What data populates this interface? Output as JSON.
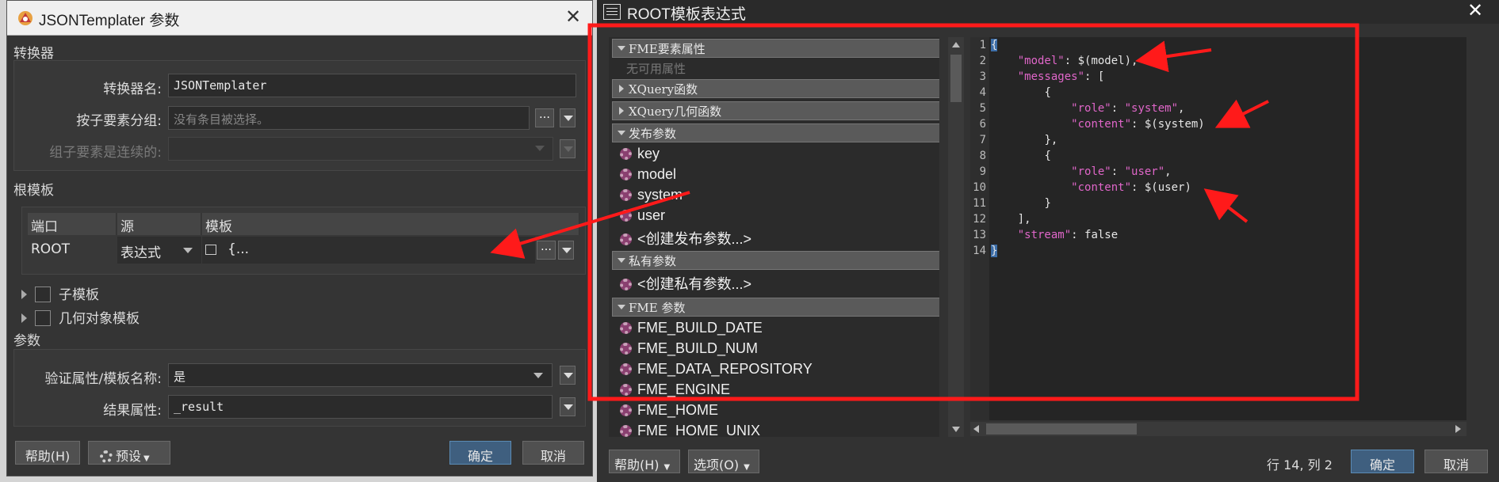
{
  "left_dialog": {
    "title": "JSONTemplater 参数",
    "section_transformer": "转换器",
    "transformer_name_label": "转换器名:",
    "transformer_name_value": "JSONTemplater",
    "group_by_label": "按子要素分组:",
    "group_by_placeholder": "没有条目被选择。",
    "group_consecutive_label": "组子要素是连续的:",
    "section_root_template": "根模板",
    "table_headers": [
      "端口",
      "源",
      "模板"
    ],
    "table_row": {
      "port": "ROOT",
      "source": "表达式",
      "template": "{..."
    },
    "sub_template": "子模板",
    "geometry_template": "几何对象模板",
    "section_params": "参数",
    "validate_label": "验证属性/模板名称:",
    "validate_value": "是",
    "result_attr_label": "结果属性:",
    "result_attr_value": "_result",
    "help_button": "帮助(H)",
    "presets_button": "预设",
    "ok_button": "确定",
    "cancel_button": "取消"
  },
  "right_dialog": {
    "title": "ROOT模板表达式",
    "tree": {
      "fme_feature_attributes": "FME要素属性",
      "no_attributes": "无可用属性",
      "xquery_functions": "XQuery函数",
      "xquery_geometry_functions": "XQuery几何函数",
      "published_params": "发布参数",
      "published_items": [
        "key",
        "model",
        "system",
        "user",
        "<创建发布参数...>"
      ],
      "private_params": "私有参数",
      "private_items": [
        "<创建私有参数...>"
      ],
      "fme_params": "FME 参数",
      "fme_items": [
        "FME_BUILD_DATE",
        "FME_BUILD_NUM",
        "FME_DATA_REPOSITORY",
        "FME_ENGINE",
        "FME_HOME",
        "FME_HOME_UNIX"
      ]
    },
    "line_numbers": [
      "1",
      "2",
      "3",
      "4",
      "5",
      "6",
      "7",
      "8",
      "9",
      "10",
      "11",
      "12",
      "13",
      "14"
    ],
    "code": {
      "l1": "{",
      "l2_key": "\"model\"",
      "l2_rest": ": $(model),",
      "l3_key": "\"messages\"",
      "l3_rest": ": [",
      "l4": "{",
      "l5_key": "\"role\"",
      "l5_mid": ": ",
      "l5_val": "\"system\"",
      "l5_end": ",",
      "l6_key": "\"content\"",
      "l6_rest": ": $(system)",
      "l7": "},",
      "l8": "{",
      "l9_key": "\"role\"",
      "l9_mid": ": ",
      "l9_val": "\"user\"",
      "l9_end": ",",
      "l10_key": "\"content\"",
      "l10_rest": ": $(user)",
      "l11": "}",
      "l12": "],",
      "l13_key": "\"stream\"",
      "l13_rest": ": false",
      "l14": "}"
    },
    "help_button": "帮助(H)",
    "options_button": "选项(O)",
    "status": "行 14, 列 2",
    "ok_button": "确定",
    "cancel_button": "取消"
  },
  "colors": {
    "annotation_red": "#ff1a1a",
    "json_key_pink": "#e066c9",
    "primary_button": "#3f5f7f"
  }
}
